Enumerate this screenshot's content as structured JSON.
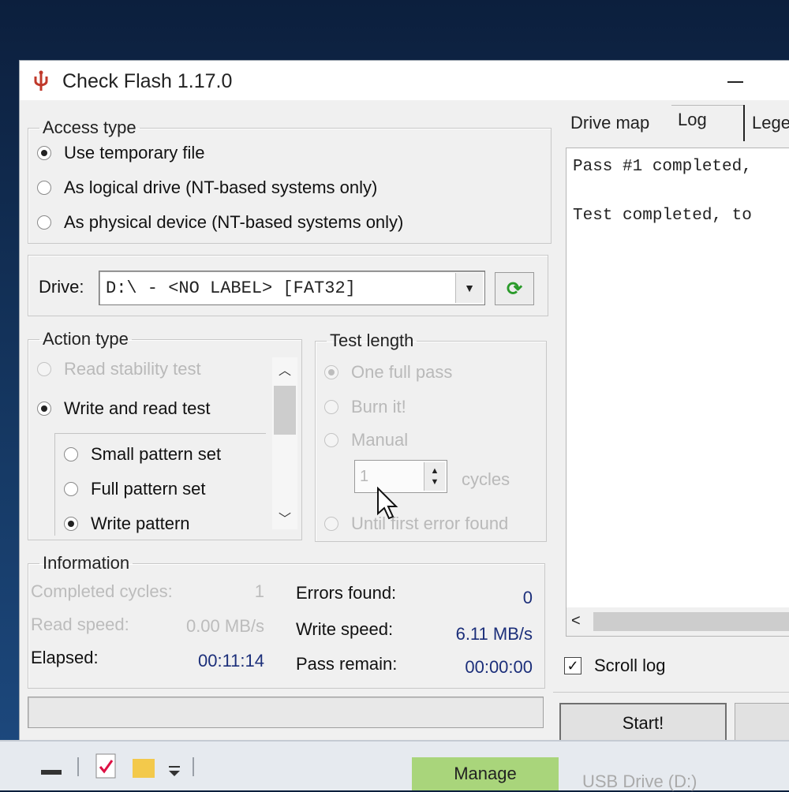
{
  "window": {
    "title": "Check Flash 1.17.0"
  },
  "access_type": {
    "label": "Access type",
    "options": [
      {
        "label": "Use temporary file",
        "selected": true
      },
      {
        "label": "As logical drive (NT-based systems only)",
        "selected": false
      },
      {
        "label": "As physical device (NT-based systems only)",
        "selected": false
      }
    ]
  },
  "drive": {
    "label": "Drive:",
    "value": "D:\\ - <NO LABEL> [FAT32]"
  },
  "action_type": {
    "label": "Action type",
    "options": [
      {
        "label": "Read stability test",
        "selected": false,
        "disabled": true
      },
      {
        "label": "Write and read test",
        "selected": true,
        "disabled": false
      }
    ],
    "sub_options": [
      {
        "label": "Small pattern set",
        "selected": false
      },
      {
        "label": "Full pattern set",
        "selected": false
      },
      {
        "label": "Write pattern",
        "selected": true
      }
    ]
  },
  "test_length": {
    "label": "Test length",
    "options": [
      {
        "label": "One full pass",
        "selected": true
      },
      {
        "label": "Burn it!",
        "selected": false
      },
      {
        "label": "Manual",
        "selected": false
      },
      {
        "label": "Until first error found",
        "selected": false
      }
    ],
    "cycles_value": "1",
    "cycles_label": "cycles"
  },
  "information": {
    "label": "Information",
    "completed_cycles": {
      "label": "Completed cycles:",
      "value": "1"
    },
    "read_speed": {
      "label": "Read speed:",
      "value": "0.00 MB/s"
    },
    "elapsed": {
      "label": "Elapsed:",
      "value": "00:11:14"
    },
    "errors_found": {
      "label": "Errors found:",
      "value": "0"
    },
    "write_speed": {
      "label": "Write speed:",
      "value": "6.11 MB/s"
    },
    "pass_remain": {
      "label": "Pass remain:",
      "value": "00:00:00"
    }
  },
  "progress": {
    "fraction": 0
  },
  "tabs": [
    {
      "label": "Drive map",
      "active": false
    },
    {
      "label": "Log",
      "active": true
    },
    {
      "label": "Lege",
      "active": false
    }
  ],
  "log": {
    "lines": [
      "Pass #1 completed,",
      "Test completed, to"
    ]
  },
  "scroll_log": {
    "label": "Scroll log",
    "checked": true
  },
  "start_button": {
    "label": "Start!"
  },
  "taskbar": {
    "manage_label": "Manage",
    "usb_label": "USB Drive (D:)"
  },
  "colors": {
    "value_blue": "#1c2f7a",
    "refresh_green": "#2a9a2a",
    "manage_green": "#a9d57b",
    "disabled_gray": "#b9b9b9"
  }
}
